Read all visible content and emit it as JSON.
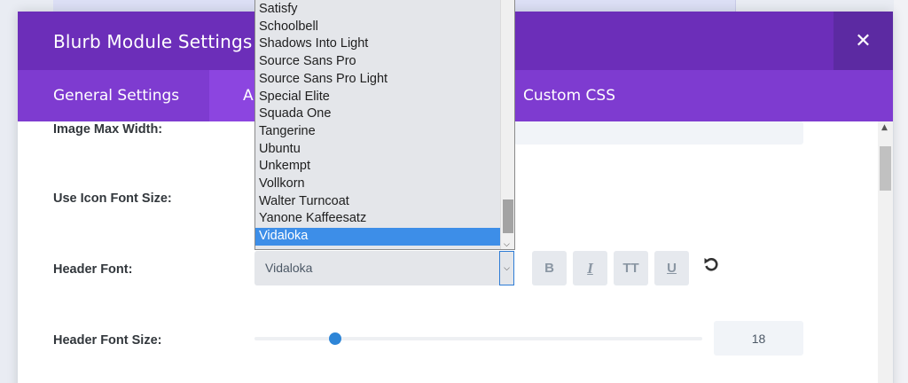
{
  "modal": {
    "title": "Blurb Module Settings",
    "close_icon": "close-icon"
  },
  "tabs": [
    {
      "label": "General Settings"
    },
    {
      "label": "A"
    },
    {
      "label": "Custom CSS"
    }
  ],
  "rows": {
    "image_max_width": "Image Max Width:",
    "use_icon_font_size": "Use Icon Font Size:",
    "header_font": "Header Font:",
    "header_font_size": "Header Font Size:"
  },
  "header_font_select": {
    "value": "Vidaloka"
  },
  "font_options": [
    "Satisfy",
    "Schoolbell",
    "Shadows Into Light",
    "Source Sans Pro",
    "Source Sans Pro Light",
    "Special Elite",
    "Squada One",
    "Tangerine",
    "Ubuntu",
    "Unkempt",
    "Vollkorn",
    "Walter Turncoat",
    "Yanone Kaffeesatz",
    "Vidaloka"
  ],
  "selected_font_index": 13,
  "format_buttons": {
    "bold": "B",
    "italic": "I",
    "uppercase": "TT",
    "underline": "U"
  },
  "header_font_size": {
    "value": "18",
    "slider_fraction": 0.18
  },
  "icons": {
    "reset": "reset-icon",
    "dropdown_arrow": "chevron-down-icon"
  }
}
